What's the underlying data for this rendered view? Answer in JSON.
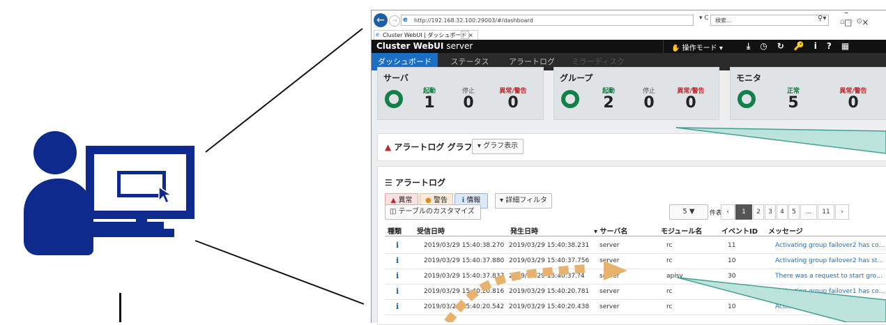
{
  "browser": {
    "url": "http://192.168.32.100:29003/#/dashboard",
    "search_placeholder": "検索...",
    "tab_title": "Cluster WebUI | ダッシュボード",
    "refresh_glyph": "▾ C"
  },
  "app": {
    "title": "Cluster WebUI",
    "server": "server",
    "op_mode": "操作モード ▾"
  },
  "nav_tabs": [
    "ダッシュボード",
    "ステータス",
    "アラートログ",
    "ミラーディスク"
  ],
  "cards": [
    {
      "title": "サーバ",
      "stats": [
        {
          "label": "起動",
          "value": "1"
        },
        {
          "label": "停止",
          "value": "0"
        },
        {
          "label": "異常/警告",
          "value": "0"
        }
      ]
    },
    {
      "title": "グループ",
      "stats": [
        {
          "label": "起動",
          "value": "2"
        },
        {
          "label": "停止",
          "value": "0"
        },
        {
          "label": "異常/警告",
          "value": "0"
        }
      ]
    },
    {
      "title": "モニタ",
      "stats": [
        {
          "label": "正常",
          "value": "5"
        },
        {
          "label": "異常/警告",
          "value": "0"
        }
      ]
    }
  ],
  "graph": {
    "title": "アラートログ グラフ",
    "toggle": "▾ グラフ表示"
  },
  "log": {
    "title": "アラートログ",
    "filters": [
      "異常",
      "警告",
      "情報"
    ],
    "detail_filter": "▾ 詳細フィルタ",
    "customize": "テーブルのカスタマイズ",
    "page_size": "5",
    "page_size_suffix": "件表示",
    "pages": [
      "‹",
      "1",
      "2",
      "3",
      "4",
      "5",
      "...",
      "11",
      "›"
    ],
    "columns": [
      "種類",
      "受信日時",
      "発生日時",
      "▾ サーバ名",
      "モジュール名",
      "イベントID",
      "メッセージ"
    ],
    "rows": [
      {
        "type": "i",
        "received": "2019/03/29 15:40:38.270",
        "occurred": "2019/03/29 15:40:38.231",
        "server": "server",
        "module": "rc",
        "event": "11",
        "message": "Activating group failover2 has co…"
      },
      {
        "type": "i",
        "received": "2019/03/29 15:40:37.880",
        "occurred": "2019/03/29 15:40:37.756",
        "server": "server",
        "module": "rc",
        "event": "10",
        "message": "Activating group failover2 has st…"
      },
      {
        "type": "i",
        "received": "2019/03/29 15:40:37.837",
        "occurred": "2019/03/29 15:40:37.?4",
        "server": "server",
        "module": "apisv",
        "event": "30",
        "message": "There was a request to start gro…"
      },
      {
        "type": "i",
        "received": "2019/03/29 15:40:20.816",
        "occurred": "2019/03/29 15:40:20.781",
        "server": "server",
        "module": "rc",
        "event": "",
        "message": "Activating group failover1 has co…"
      },
      {
        "type": "i",
        "received": "2019/03/29 15:40:20.542",
        "occurred": "2019/03/29 15:40:20.438",
        "server": "server",
        "module": "rc",
        "event": "10",
        "message": "Acti…"
      }
    ]
  },
  "colors": {
    "figure": "#0d2a8c",
    "callout": "#b9e3dc",
    "arrow": "#e7b26e",
    "accent": "#1a6fc4",
    "ok_green": "#13804a",
    "alert_red": "#c0282d"
  }
}
